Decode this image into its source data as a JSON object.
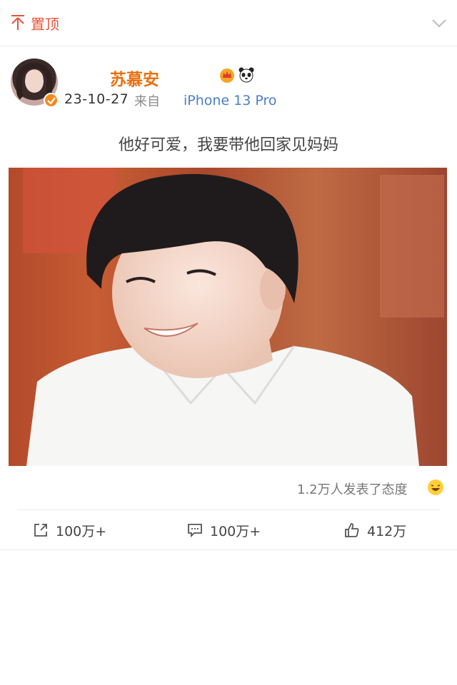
{
  "topbar": {
    "pin_label": "置顶"
  },
  "post": {
    "username": "苏慕安",
    "date": "23-10-27",
    "from_label": "来自",
    "device": "iPhone 13 Pro",
    "text": "他好可爱，我要带他回家见妈妈"
  },
  "reactions": {
    "count_label": "1.2万人发表了态度"
  },
  "actions": {
    "repost": "100万+",
    "comment": "100万+",
    "like": "412万"
  },
  "colors": {
    "accent_orange": "#e8700e",
    "link_blue": "#4a7fc9",
    "pin_red": "#e8533a"
  }
}
